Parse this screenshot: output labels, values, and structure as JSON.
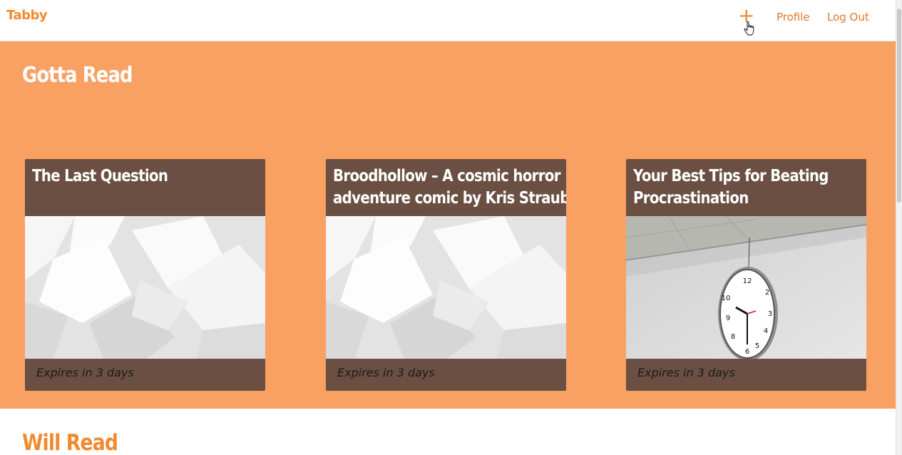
{
  "navbar": {
    "brand": "Tabby",
    "add_label": "+",
    "profile_label": "Profile",
    "logout_label": "Log Out"
  },
  "colors": {
    "accent": "#f08a2e",
    "section_bg": "#f9a063",
    "card_bg": "#6a4f42"
  },
  "gotta_read": {
    "title": "Gotta Read",
    "cards": [
      {
        "title_line1": "The Last Question",
        "title_line2": "",
        "expires": "Expires in 3 days",
        "image": "placeholder-pattern"
      },
      {
        "title_line1": "Broodhollow – A cosmic horror",
        "title_line2": "adventure comic by Kris Straub",
        "expires": "Expires in 3 days",
        "image": "placeholder-pattern"
      },
      {
        "title_line1": "Your Best Tips for Beating",
        "title_line2": "Procrastination",
        "expires": "Expires in 3 days",
        "image": "wall-clock-photo"
      }
    ]
  },
  "will_read": {
    "title": "Will Read"
  },
  "icons": {
    "cursor": "hand-pointer-icon"
  }
}
